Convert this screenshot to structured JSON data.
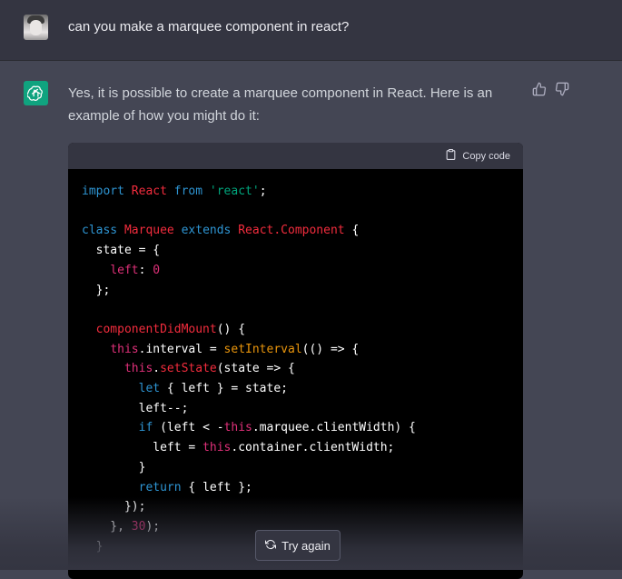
{
  "user_message": {
    "text": "can you make a marquee component in react?",
    "avatar_icon": "user-avatar"
  },
  "assistant_message": {
    "logo_icon": "openai-logo-icon",
    "intro_text": "Yes, it is possible to create a marquee component in React. Here is an example of how you might do it:",
    "thumbs_up_icon": "thumbs-up-icon",
    "thumbs_down_icon": "thumbs-down-icon"
  },
  "code_block": {
    "copy_label": "Copy code",
    "copy_icon": "clipboard-icon",
    "lines": [
      "import React from 'react';",
      "",
      "class Marquee extends React.Component {",
      "  state = {",
      "    left: 0",
      "  };",
      "",
      "  componentDidMount() {",
      "    this.interval = setInterval(() => {",
      "      this.setState(state => {",
      "        let { left } = state;",
      "        left--;",
      "        if (left < -this.marquee.clientWidth) {",
      "          left = this.container.clientWidth;",
      "        }",
      "        return { left };",
      "      });",
      "    }, 30);",
      "  }"
    ]
  },
  "try_again": {
    "label": "Try again",
    "icon": "refresh-icon"
  },
  "colors": {
    "page_bg": "#444654",
    "user_row_bg": "#343541",
    "accent_logo": "#10a37f",
    "code_bg": "#000000",
    "keyword": "#2e95d3",
    "class_name": "#f22c3d",
    "string": "#00a67d",
    "number": "#df3079",
    "builtin_fn": "#e9950c"
  }
}
